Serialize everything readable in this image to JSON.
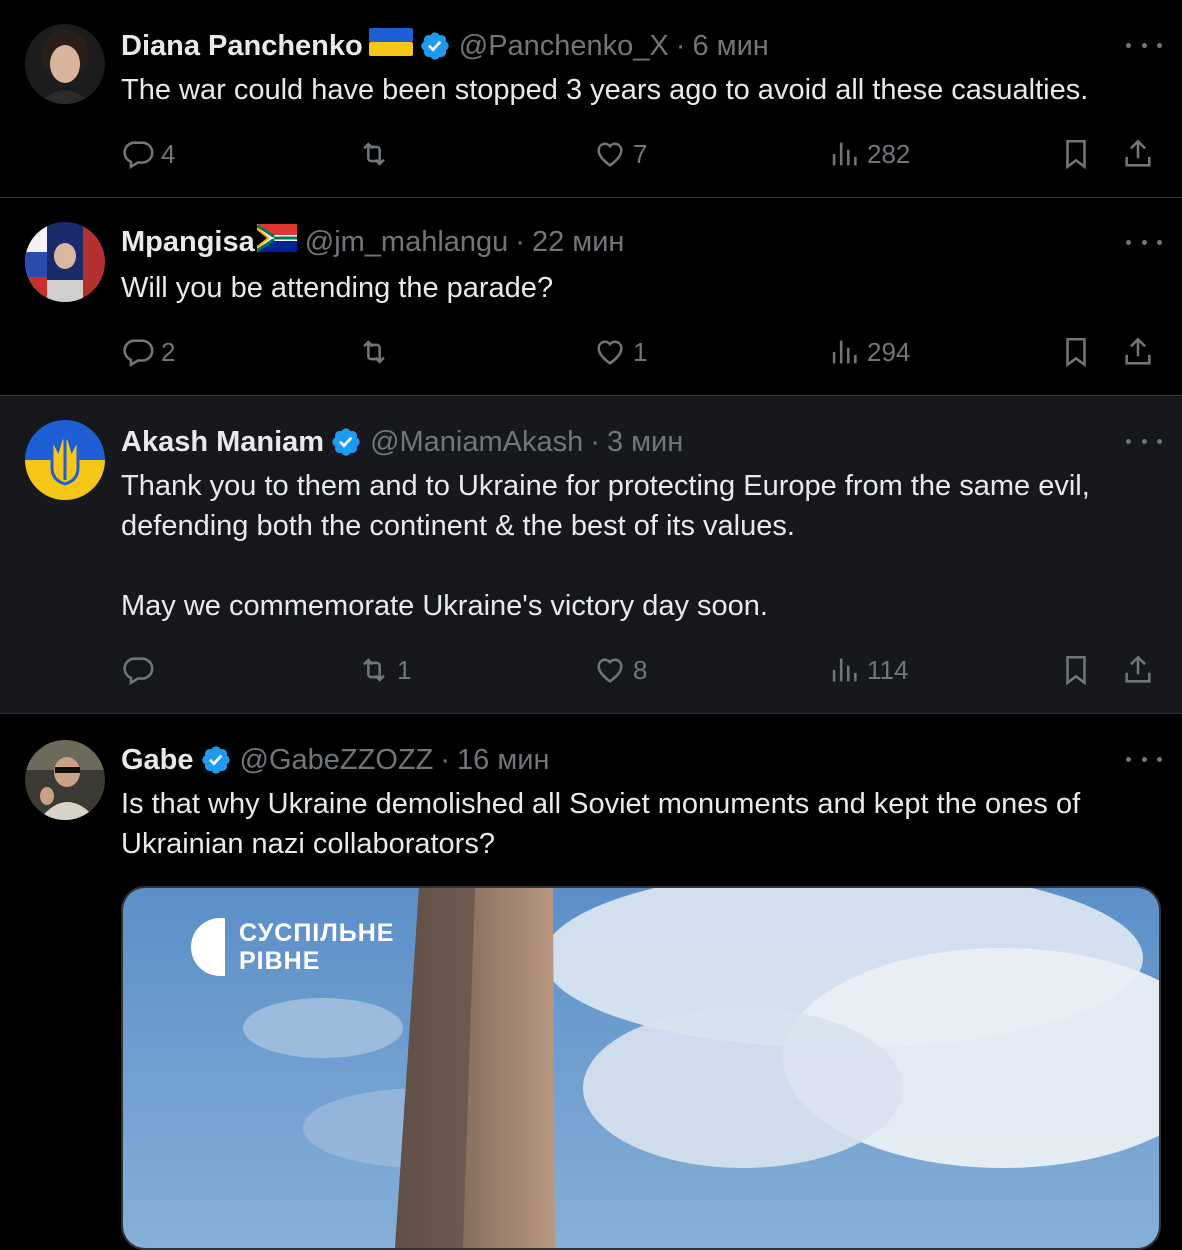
{
  "tweets": [
    {
      "name": "Diana Panchenko",
      "flag": "ukraine",
      "verified": true,
      "handle": "@Panchenko_X",
      "separator": "·",
      "time": "6 мин",
      "text": [
        "The war could have been stopped 3 years ago to avoid all these casualties."
      ],
      "replies": "4",
      "retweets": "",
      "likes": "7",
      "views": "282"
    },
    {
      "name": "Mpangisa",
      "flag": "south-africa",
      "verified": false,
      "handle": "@jm_mahlangu",
      "separator": "·",
      "time": "22 мин",
      "text": [
        "Will you be attending the parade?"
      ],
      "replies": "2",
      "retweets": "",
      "likes": "1",
      "views": "294"
    },
    {
      "name": "Akash Maniam",
      "flag": "",
      "verified": true,
      "handle": "@ManiamAkash",
      "separator": "·",
      "time": "3 мин",
      "text": [
        "Thank you to them and to Ukraine for protecting Europe from the same evil, defending both the continent & the best of its values.",
        "May we commemorate Ukraine's victory day soon."
      ],
      "replies": "",
      "retweets": "1",
      "likes": "8",
      "views": "114"
    },
    {
      "name": "Gabe",
      "flag": "",
      "verified": true,
      "handle": "@GabeZZOZZ",
      "separator": "·",
      "time": "16 мин",
      "text": [
        "Is that why Ukraine demolished all Soviet monuments and kept the ones of Ukrainian nazi collaborators?"
      ],
      "replies": "",
      "retweets": "",
      "likes": "",
      "views": "",
      "media": {
        "watermark_line1": "СУСПІЛЬНЕ",
        "watermark_line2": "РІВНЕ"
      }
    }
  ],
  "icons": {
    "reply": "reply-icon",
    "retweet": "retweet-icon",
    "like": "heart-icon",
    "views": "views-icon",
    "bookmark": "bookmark-icon",
    "share": "share-icon",
    "more": "more-icon",
    "verified": "verified-badge-icon"
  },
  "colors": {
    "background": "#000000",
    "highlight": "#16181c",
    "text": "#e7e9ea",
    "muted": "#71767b",
    "verified": "#1d9bf0",
    "border": "#2f3336"
  }
}
